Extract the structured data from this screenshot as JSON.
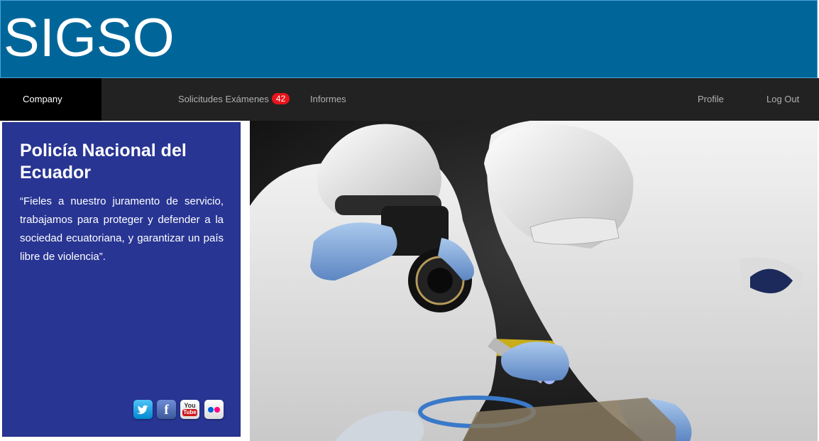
{
  "header": {
    "brand": "SIGSO",
    "brand_color": "#006699"
  },
  "navbar": {
    "company": "Company",
    "solicitudes_label": "Solicitudes Exámenes",
    "solicitudes_count": "42",
    "informes": "Informes",
    "profile": "Profile",
    "logout": "Log Out",
    "badge_color": "#e8141b"
  },
  "panel": {
    "title": "Policía Nacional del Ecuador",
    "motto": "“Fieles a nuestro juramento de servicio, trabajamos para proteger y defender a la sociedad ecuatoriana, y garantizar un país libre de violencia”.",
    "background": "#283593",
    "social": {
      "twitter_icon": "twitter-icon",
      "facebook_icon": "facebook-icon",
      "youtube_icon": "youtube-icon",
      "flickr_icon": "flickr-icon",
      "facebook_glyph": "f",
      "youtube_top": "You",
      "youtube_bottom": "Tube"
    }
  },
  "hero": {
    "image_subject": "forensic-investigators-photo"
  }
}
